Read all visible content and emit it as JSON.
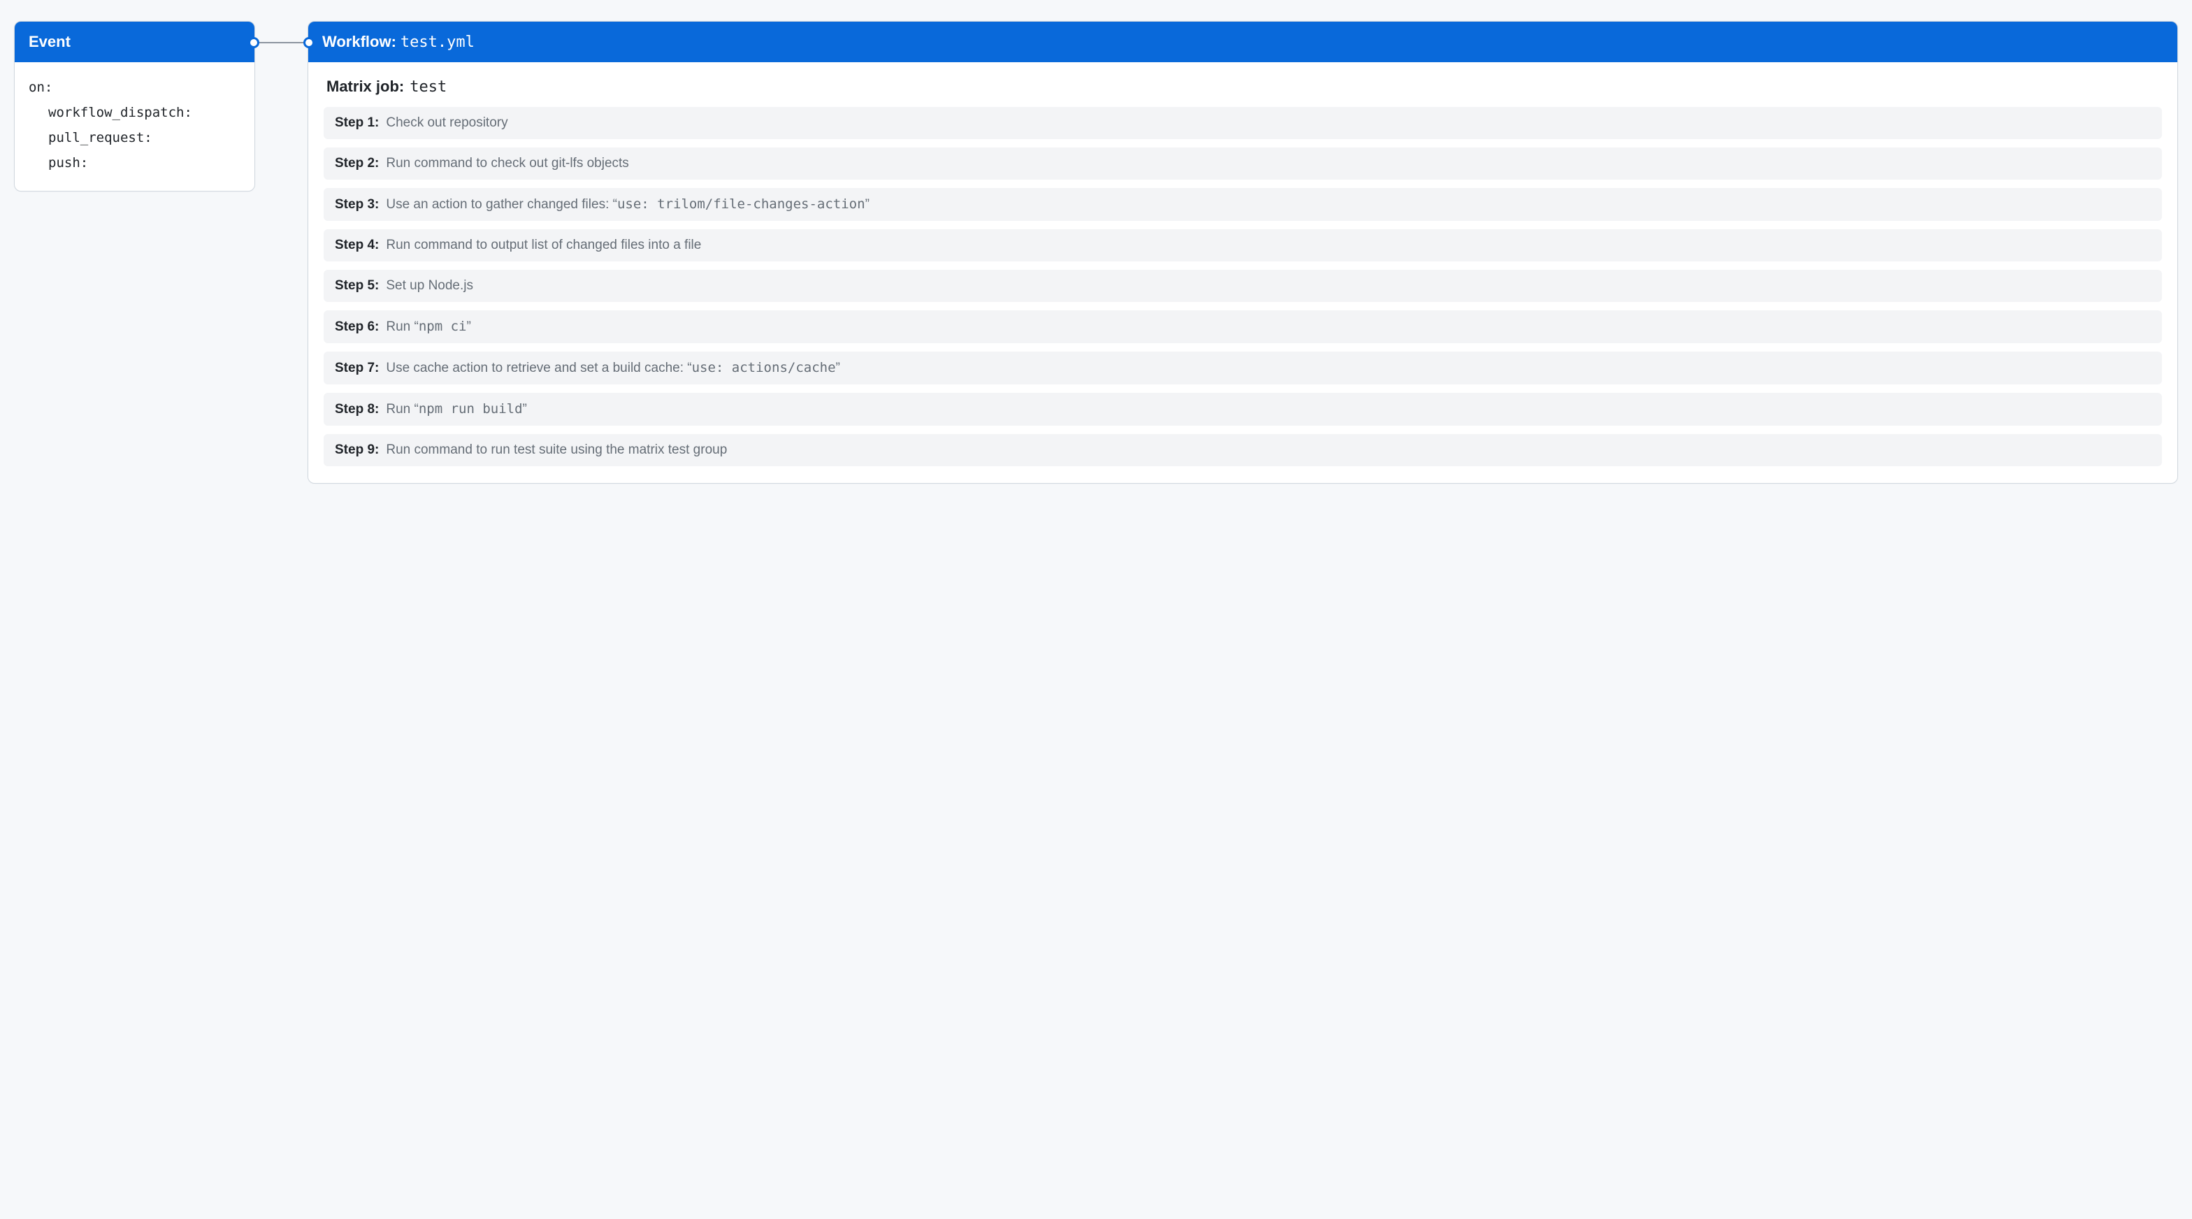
{
  "event": {
    "header": "Event",
    "code_root": "on:",
    "triggers": [
      "workflow_dispatch:",
      "pull_request:",
      "push:"
    ]
  },
  "workflow": {
    "header_prefix": "Workflow: ",
    "filename": "test.yml",
    "job_prefix": "Matrix job: ",
    "job_name": "test",
    "steps": [
      {
        "label": "Step 1:",
        "parts": [
          {
            "t": "Check out repository"
          }
        ]
      },
      {
        "label": "Step 2:",
        "parts": [
          {
            "t": "Run command to check out git-lfs objects"
          }
        ]
      },
      {
        "label": "Step 3:",
        "parts": [
          {
            "t": "Use an action to gather changed files: “"
          },
          {
            "t": "use: trilom/file-changes-action",
            "mono": true
          },
          {
            "t": "”"
          }
        ]
      },
      {
        "label": "Step 4:",
        "parts": [
          {
            "t": "Run command to output list of changed files into a file"
          }
        ]
      },
      {
        "label": "Step 5:",
        "parts": [
          {
            "t": "Set up Node.js"
          }
        ]
      },
      {
        "label": "Step 6:",
        "parts": [
          {
            "t": "Run “"
          },
          {
            "t": "npm ci",
            "mono": true
          },
          {
            "t": "”"
          }
        ]
      },
      {
        "label": "Step 7:",
        "parts": [
          {
            "t": "Use cache action to retrieve and set a build cache: “"
          },
          {
            "t": "use: actions/cache",
            "mono": true
          },
          {
            "t": "”"
          }
        ]
      },
      {
        "label": "Step 8:",
        "parts": [
          {
            "t": "Run “"
          },
          {
            "t": "npm run build",
            "mono": true
          },
          {
            "t": "”"
          }
        ]
      },
      {
        "label": "Step 9:",
        "parts": [
          {
            "t": "Run command to run test suite using the matrix test group"
          }
        ]
      }
    ]
  }
}
